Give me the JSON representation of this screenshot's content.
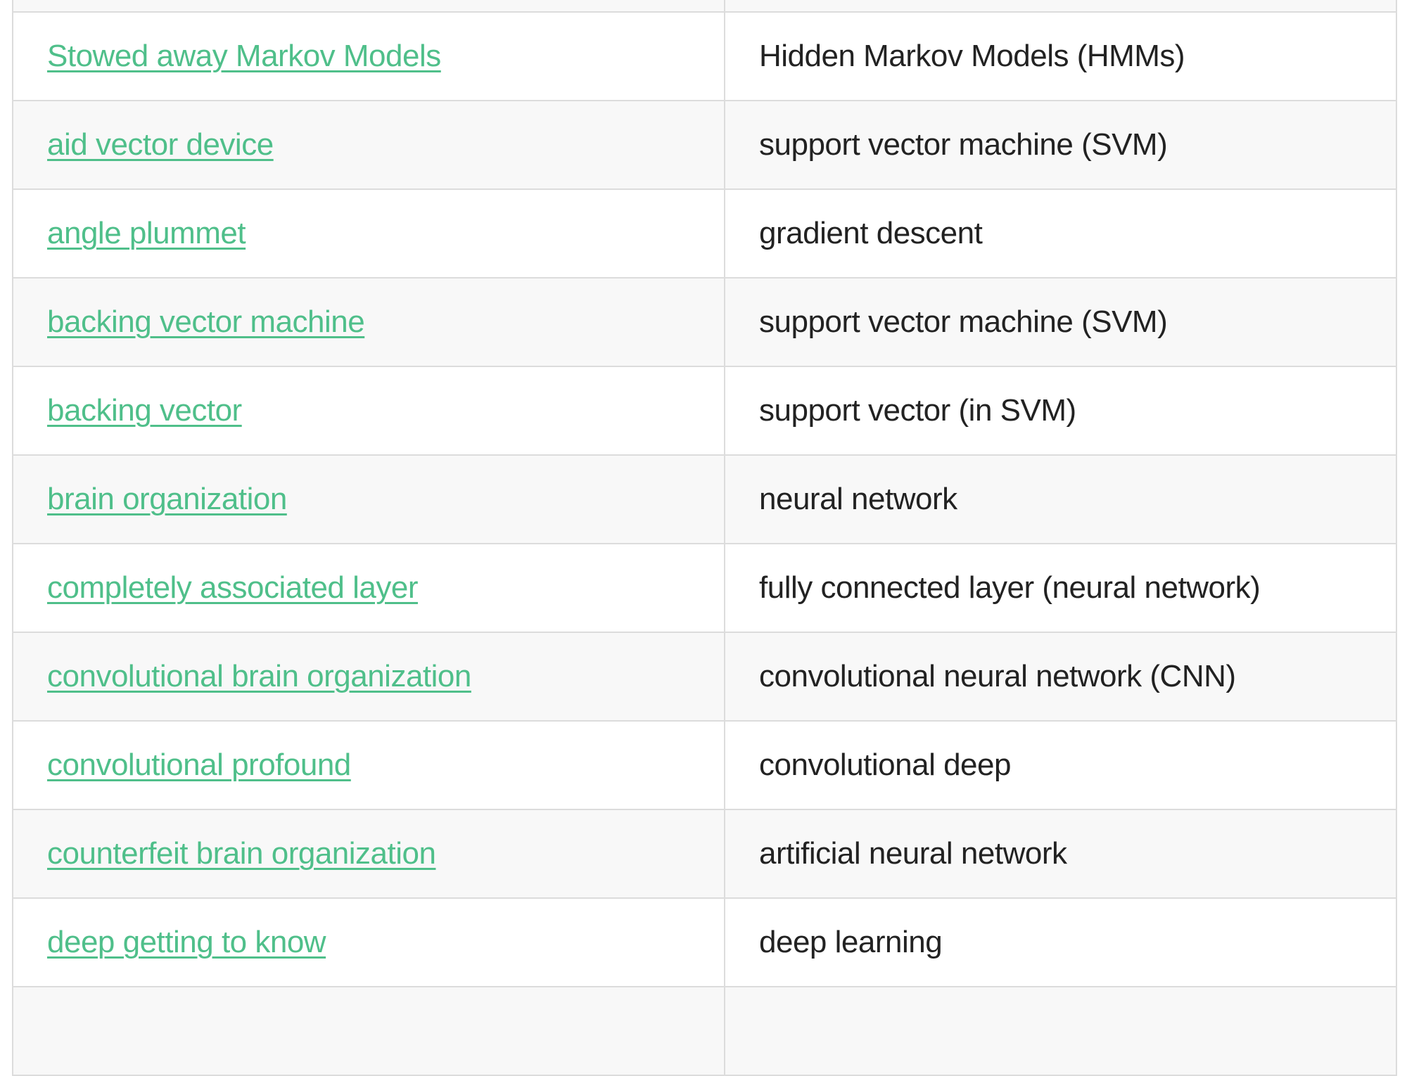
{
  "link_color": "#4fbf8a",
  "rows": [
    {
      "term": "",
      "meaning": ""
    },
    {
      "term": "Stowed away Markov Models",
      "meaning": "Hidden Markov Models (HMMs)"
    },
    {
      "term": "aid vector device",
      "meaning": "support vector machine (SVM)"
    },
    {
      "term": "angle plummet",
      "meaning": "gradient descent"
    },
    {
      "term": "backing vector machine",
      "meaning": "support vector machine (SVM)"
    },
    {
      "term": "backing vector",
      "meaning": "support vector (in SVM)"
    },
    {
      "term": "brain organization",
      "meaning": "neural network"
    },
    {
      "term": "completely associated layer",
      "meaning": "fully connected layer (neural network)"
    },
    {
      "term": "convolutional brain organization",
      "meaning": "convolutional neural network (CNN)"
    },
    {
      "term": "convolutional profound",
      "meaning": "convolutional deep"
    },
    {
      "term": "counterfeit brain organization",
      "meaning": "artificial neural network"
    },
    {
      "term": "deep getting to know",
      "meaning": "deep learning"
    },
    {
      "term": "",
      "meaning": ""
    }
  ]
}
